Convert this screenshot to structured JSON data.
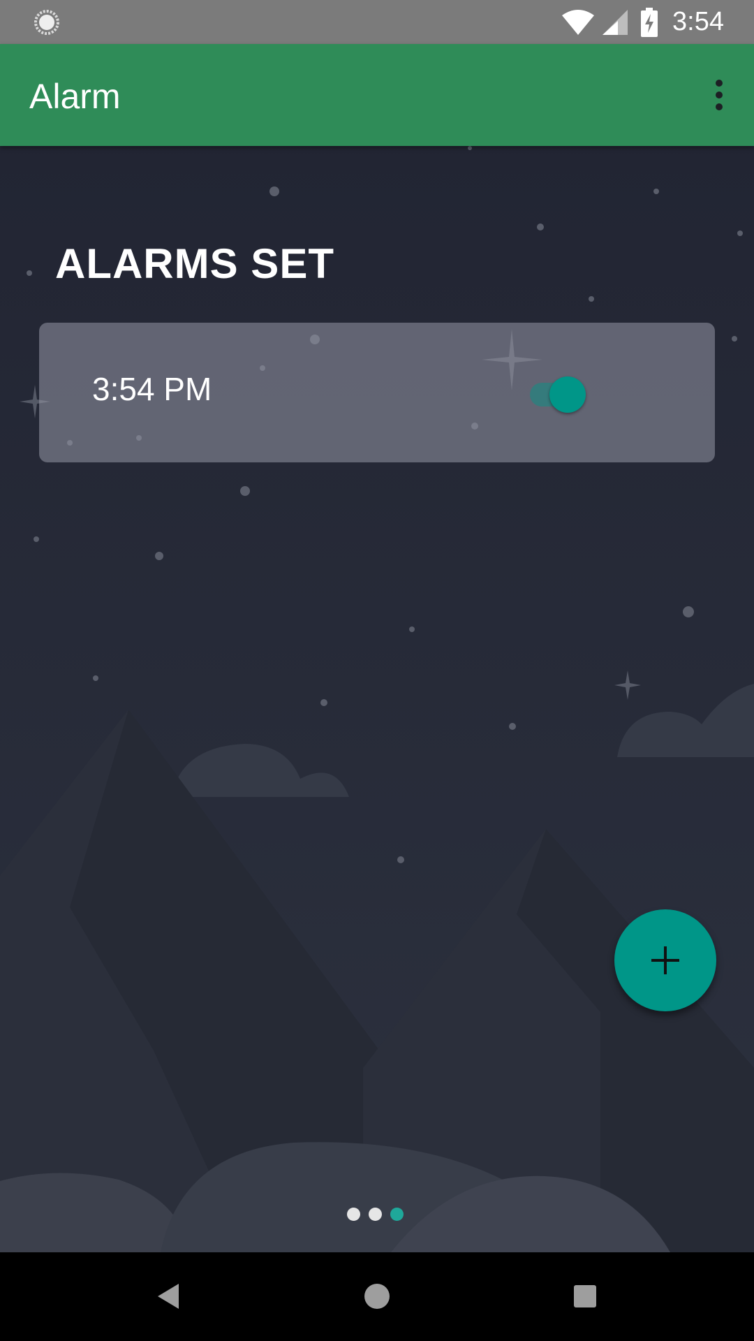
{
  "status_bar": {
    "time": "3:54",
    "icons": [
      "loading-icon",
      "wifi-icon",
      "signal-icon",
      "battery-charging-icon"
    ]
  },
  "app_bar": {
    "title": "Alarm",
    "menu_icon": "more-vert-icon",
    "color": "#2f8c58"
  },
  "main": {
    "section_title": "ALARMS SET",
    "alarms": [
      {
        "time": "3:54 PM",
        "enabled": true
      }
    ],
    "fab_icon": "add-icon",
    "accent": "#009688",
    "page_indicator": {
      "count": 3,
      "active_index": 2
    }
  },
  "nav_bar": {
    "buttons": [
      "back-icon",
      "home-icon",
      "recents-icon"
    ]
  }
}
